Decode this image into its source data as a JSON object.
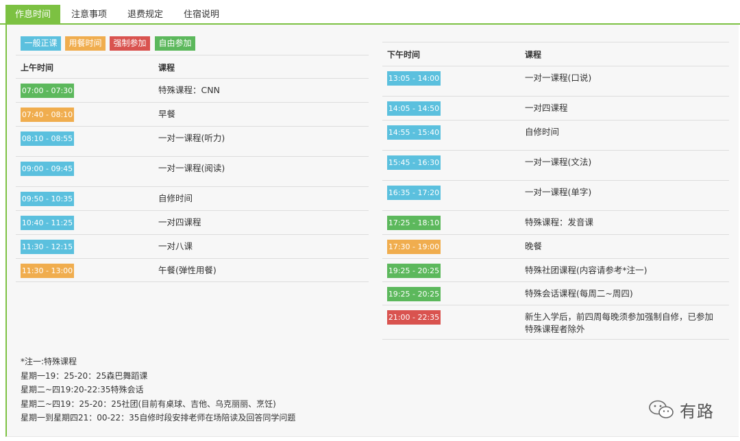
{
  "tabs": [
    {
      "label": "作息时间",
      "active": true
    },
    {
      "label": "注意事项",
      "active": false
    },
    {
      "label": "退费规定",
      "active": false
    },
    {
      "label": "住宿说明",
      "active": false
    }
  ],
  "legend": [
    {
      "label": "一般正课",
      "color": "#5bc0de"
    },
    {
      "label": "用餐时间",
      "color": "#f0ad4e"
    },
    {
      "label": "强制参加",
      "color": "#d9534f"
    },
    {
      "label": "自由参加",
      "color": "#5cb85c"
    }
  ],
  "morning": {
    "header_time": "上午时间",
    "header_course": "课程",
    "rows": [
      {
        "time": "07:00 - 07:30",
        "course": "特殊课程：CNN",
        "type": "green"
      },
      {
        "time": "07:40 - 08:10",
        "course": "早餐",
        "type": "orange"
      },
      {
        "time": "08:10 - 08:55",
        "course": "一对一课程(听力)",
        "type": "blue"
      },
      {
        "time": "09:00 - 09:45",
        "course": "一对一课程(阅读)",
        "type": "blue"
      },
      {
        "time": "09:50 - 10:35",
        "course": "自修时间",
        "type": "blue"
      },
      {
        "time": "10:40 - 11:25",
        "course": "一对四课程",
        "type": "blue"
      },
      {
        "time": "11:30 - 12:15",
        "course": "一对八课",
        "type": "blue"
      },
      {
        "time": "11:30 - 13:00",
        "course": "午餐(弹性用餐)",
        "type": "orange"
      }
    ]
  },
  "afternoon": {
    "header_time": "下午时间",
    "header_course": "课程",
    "rows": [
      {
        "time": "13:05 - 14:00",
        "course": "一对一课程(口说)",
        "type": "blue"
      },
      {
        "time": "14:05 - 14:50",
        "course": "一对四课程",
        "type": "blue"
      },
      {
        "time": "14:55 - 15:40",
        "course": "自修时间",
        "type": "blue"
      },
      {
        "time": "15:45 - 16:30",
        "course": "一对一课程(文法)",
        "type": "blue"
      },
      {
        "time": "16:35 - 17:20",
        "course": "一对一课程(单字)",
        "type": "blue"
      },
      {
        "time": "17:25 - 18:10",
        "course": "特殊课程：发音课",
        "type": "green"
      },
      {
        "time": "17:30 - 19:00",
        "course": "晚餐",
        "type": "orange"
      },
      {
        "time": "19:25 - 20:25",
        "course": "特殊社团课程(内容请参考*注一)",
        "type": "green"
      },
      {
        "time": "19:25 - 20:25",
        "course": "特殊会话课程(每周二~周四)",
        "type": "green"
      },
      {
        "time": "21:00 - 22:35",
        "course": "新生入学后，前四周每晚须参加强制自修，已参加特殊课程者除外",
        "type": "red"
      }
    ]
  },
  "notes": [
    "*注一:特殊课程",
    "星期一19：25-20：25森巴舞蹈课",
    "星期二~四19:20-22:35特殊会话",
    "星期二~四19：25-20：25社团(目前有桌球、吉他、乌克丽丽、烹饪)",
    "星期一到星期四21：00-22：35自修时段安排老师在场陪读及回答同学问题"
  ],
  "watermark": {
    "text": "有路",
    "icon": "wechat-icon"
  }
}
